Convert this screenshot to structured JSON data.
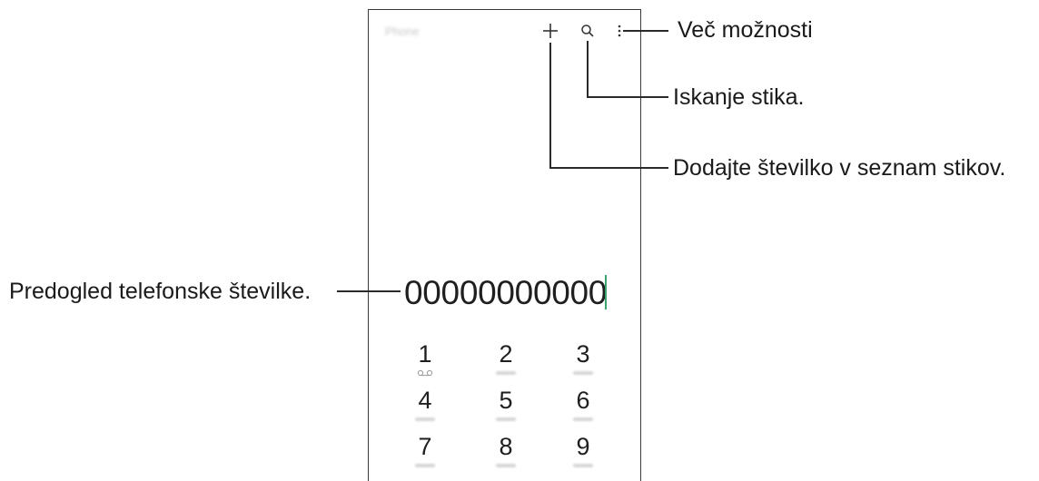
{
  "app": {
    "title": "Phone"
  },
  "toolbar": {
    "add_icon": "plus-icon",
    "search_icon": "search-icon",
    "more_icon": "more-vertical-icon"
  },
  "callouts": {
    "more_options": "Več možnosti",
    "search_contacts": "Iskanje stika.",
    "add_number": "Dodajte številko v seznam stikov.",
    "number_preview": "Predogled telefonske številke."
  },
  "dialer": {
    "number": "00000000000",
    "keys": [
      {
        "digit": "1"
      },
      {
        "digit": "2"
      },
      {
        "digit": "3"
      },
      {
        "digit": "4"
      },
      {
        "digit": "5"
      },
      {
        "digit": "6"
      },
      {
        "digit": "7"
      },
      {
        "digit": "8"
      },
      {
        "digit": "9"
      }
    ],
    "voicemail_icon": "voicemail-icon"
  },
  "colors": {
    "cursor": "#3aa36d",
    "frame": "#3a3a3a"
  }
}
